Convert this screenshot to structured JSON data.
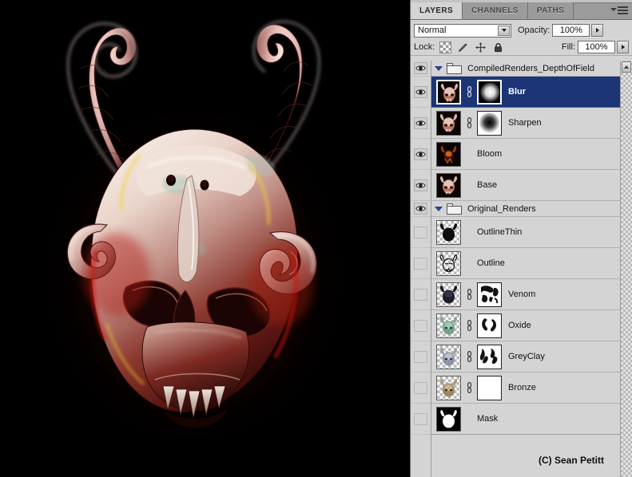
{
  "app": {
    "title": "Adobe Photoshop — Layers Panel",
    "canvas_background": "#000000",
    "panel_background": "#d4d4d4",
    "selection_color": "#1c3577"
  },
  "panel": {
    "tabs": [
      {
        "label": "LAYERS",
        "active": true
      },
      {
        "label": "CHANNELS",
        "active": false
      },
      {
        "label": "PATHS",
        "active": false
      }
    ],
    "menu_icon": "panel-menu-icon",
    "blend_mode": {
      "value": "Normal",
      "dropdown_icon": "chevron-down-icon"
    },
    "opacity": {
      "label": "Opacity:",
      "value": "100%",
      "stepper_icon": "caret-right-icon"
    },
    "fill": {
      "label": "Fill:",
      "value": "100%",
      "stepper_icon": "caret-right-icon"
    },
    "lock": {
      "label": "Lock:",
      "icons": [
        "lock-transparent-pixels-icon",
        "lock-image-pixels-icon",
        "lock-position-icon",
        "lock-all-icon"
      ]
    },
    "scrollbar": {
      "up_arrow_icon": "scroll-up-arrow-icon"
    }
  },
  "layers": [
    {
      "name": "CompiledRenders_DepthOfField",
      "type": "group",
      "visible": true,
      "expanded": true,
      "twisty_icon": "triangle-down-icon",
      "folder_icon": "folder-icon"
    },
    {
      "name": "Blur",
      "type": "layer",
      "visible": true,
      "selected": true,
      "has_mask": true,
      "linked": true,
      "thumbnail": "demon-skull-render",
      "mask_style": "white-radial-on-black",
      "link_icon": "chain-link-icon"
    },
    {
      "name": "Sharpen",
      "type": "layer",
      "visible": true,
      "selected": false,
      "has_mask": true,
      "linked": true,
      "thumbnail": "demon-skull-render",
      "mask_style": "black-radial-on-white",
      "link_icon": "chain-link-icon"
    },
    {
      "name": "Bloom",
      "type": "layer",
      "visible": true,
      "selected": false,
      "has_mask": false,
      "linked": false,
      "thumbnail": "demon-skull-bloom"
    },
    {
      "name": "Base",
      "type": "layer",
      "visible": true,
      "selected": false,
      "has_mask": false,
      "linked": false,
      "thumbnail": "demon-skull-render"
    },
    {
      "name": "Original_Renders",
      "type": "group",
      "visible": true,
      "expanded": true,
      "twisty_icon": "triangle-down-icon",
      "folder_icon": "folder-icon"
    },
    {
      "name": "OutlineThin",
      "type": "layer",
      "visible": false,
      "selected": false,
      "has_mask": false,
      "linked": false,
      "thumbnail": "skull-silhouette-solid"
    },
    {
      "name": "Outline",
      "type": "layer",
      "visible": false,
      "selected": false,
      "has_mask": false,
      "linked": false,
      "thumbnail": "skull-outline-sketch"
    },
    {
      "name": "Venom",
      "type": "layer",
      "visible": false,
      "selected": false,
      "has_mask": true,
      "linked": true,
      "thumbnail": "skull-dark-blue",
      "mask_style": "sketch-mask",
      "link_icon": "chain-link-icon"
    },
    {
      "name": "Oxide",
      "type": "layer",
      "visible": false,
      "selected": false,
      "has_mask": true,
      "linked": true,
      "thumbnail": "skull-green-oxide",
      "mask_style": "horn-strokes-mask",
      "link_icon": "chain-link-icon"
    },
    {
      "name": "GreyClay",
      "type": "layer",
      "visible": false,
      "selected": false,
      "has_mask": true,
      "linked": true,
      "thumbnail": "skull-grey-clay",
      "mask_style": "brush-strokes-mask",
      "link_icon": "chain-link-icon"
    },
    {
      "name": "Bronze",
      "type": "layer",
      "visible": false,
      "selected": false,
      "has_mask": true,
      "linked": true,
      "thumbnail": "skull-bronze",
      "mask_style": "solid-white-mask",
      "link_icon": "chain-link-icon"
    },
    {
      "name": "Mask",
      "type": "layer",
      "visible": false,
      "selected": false,
      "has_mask": false,
      "linked": false,
      "thumbnail": "skull-white-on-black"
    }
  ],
  "artwork": {
    "description": "Glossy red and pearl-white demon skull with large curved spiral horns",
    "credit": "(C) Sean Petitt"
  }
}
